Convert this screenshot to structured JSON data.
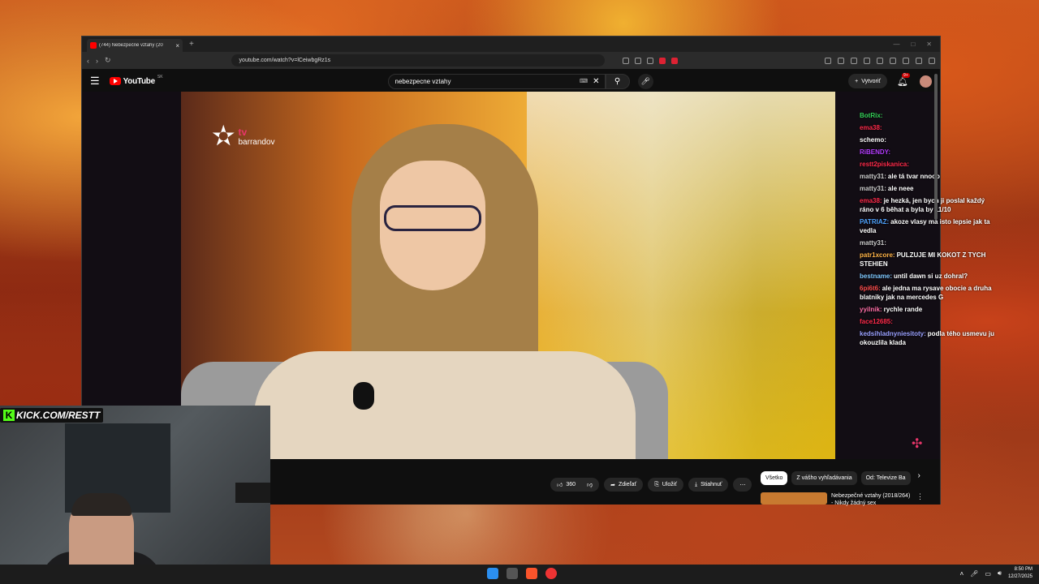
{
  "browser": {
    "tab_title": "(744) Nebezpečné vztahy (20",
    "url": "youtube.com/watch?v=lCeiwbgRz1s"
  },
  "youtube": {
    "logo_text": "YouTube",
    "logo_country": "SK",
    "search_value": "nebezpecne vztahy",
    "create_label": "Vytvoriť",
    "notif_count": "9+"
  },
  "video": {
    "channel_tv": "tv",
    "channel_name": "barrandov"
  },
  "chat": {
    "messages": [
      {
        "user": "BotRix:",
        "text": "",
        "color": "#34d058"
      },
      {
        "user": "ema38:",
        "text": "",
        "color": "#ff2a4a"
      },
      {
        "user": "schemo:",
        "text": "",
        "color": "#ffffff"
      },
      {
        "user": "RiBENDY:",
        "text": "",
        "color": "#b43cff"
      },
      {
        "user": "restt2piskanica:",
        "text": "",
        "color": "#ff2a4a"
      },
      {
        "user": "matty31:",
        "text": "ale tá tvar nnooo",
        "color": "#cccccc"
      },
      {
        "user": "matty31:",
        "text": "ale neee",
        "color": "#cccccc"
      },
      {
        "user": "ema38:",
        "text": "je hezká, jen bych ji poslal každý ráno v 6 běhat a byla by 11/10",
        "color": "#ff2a4a"
      },
      {
        "user": "PATRIAZ:",
        "text": "akoze vlasy ma isto lepsie jak ta vedla",
        "color": "#4fa3ff"
      },
      {
        "user": "matty31:",
        "text": "",
        "color": "#cccccc"
      },
      {
        "user": "patr1xcore:",
        "text": "PULZUJE MI KOKOT Z TYCH STEHIEN",
        "color": "#ffb347"
      },
      {
        "user": "bestname:",
        "text": "until dawn si uz dohral?",
        "color": "#7fc8ff"
      },
      {
        "user": "6pi6t6:",
        "text": "ale jedna ma rysave obocie a druha blatniky jak na mercedes G",
        "color": "#ff4d4d"
      },
      {
        "user": "yyilnik:",
        "text": "rychle rande",
        "color": "#ff6fa8"
      },
      {
        "user": "face12685:",
        "text": "",
        "color": "#ff2a4a"
      },
      {
        "user": "kedsihladnyniesitoty:",
        "text": "podla tého usmevu ju okouzlila klada",
        "color": "#9aa0ff"
      }
    ]
  },
  "actions": {
    "like_count": "360",
    "share": "Zdieľať",
    "save": "Uložiť",
    "download": "Stiahnuť"
  },
  "chips": [
    "Všetko",
    "Z vášho vyhľadávania",
    "Od: Televize Ba"
  ],
  "recommended": {
    "title": "Nebezpečné vztahy (2018/264) - Nikdy žádný sex"
  },
  "overlay": {
    "kick_text": "KICK.COM/RESTT"
  },
  "taskbar": {
    "time": "8:50 PM",
    "date": "12/27/2025"
  }
}
